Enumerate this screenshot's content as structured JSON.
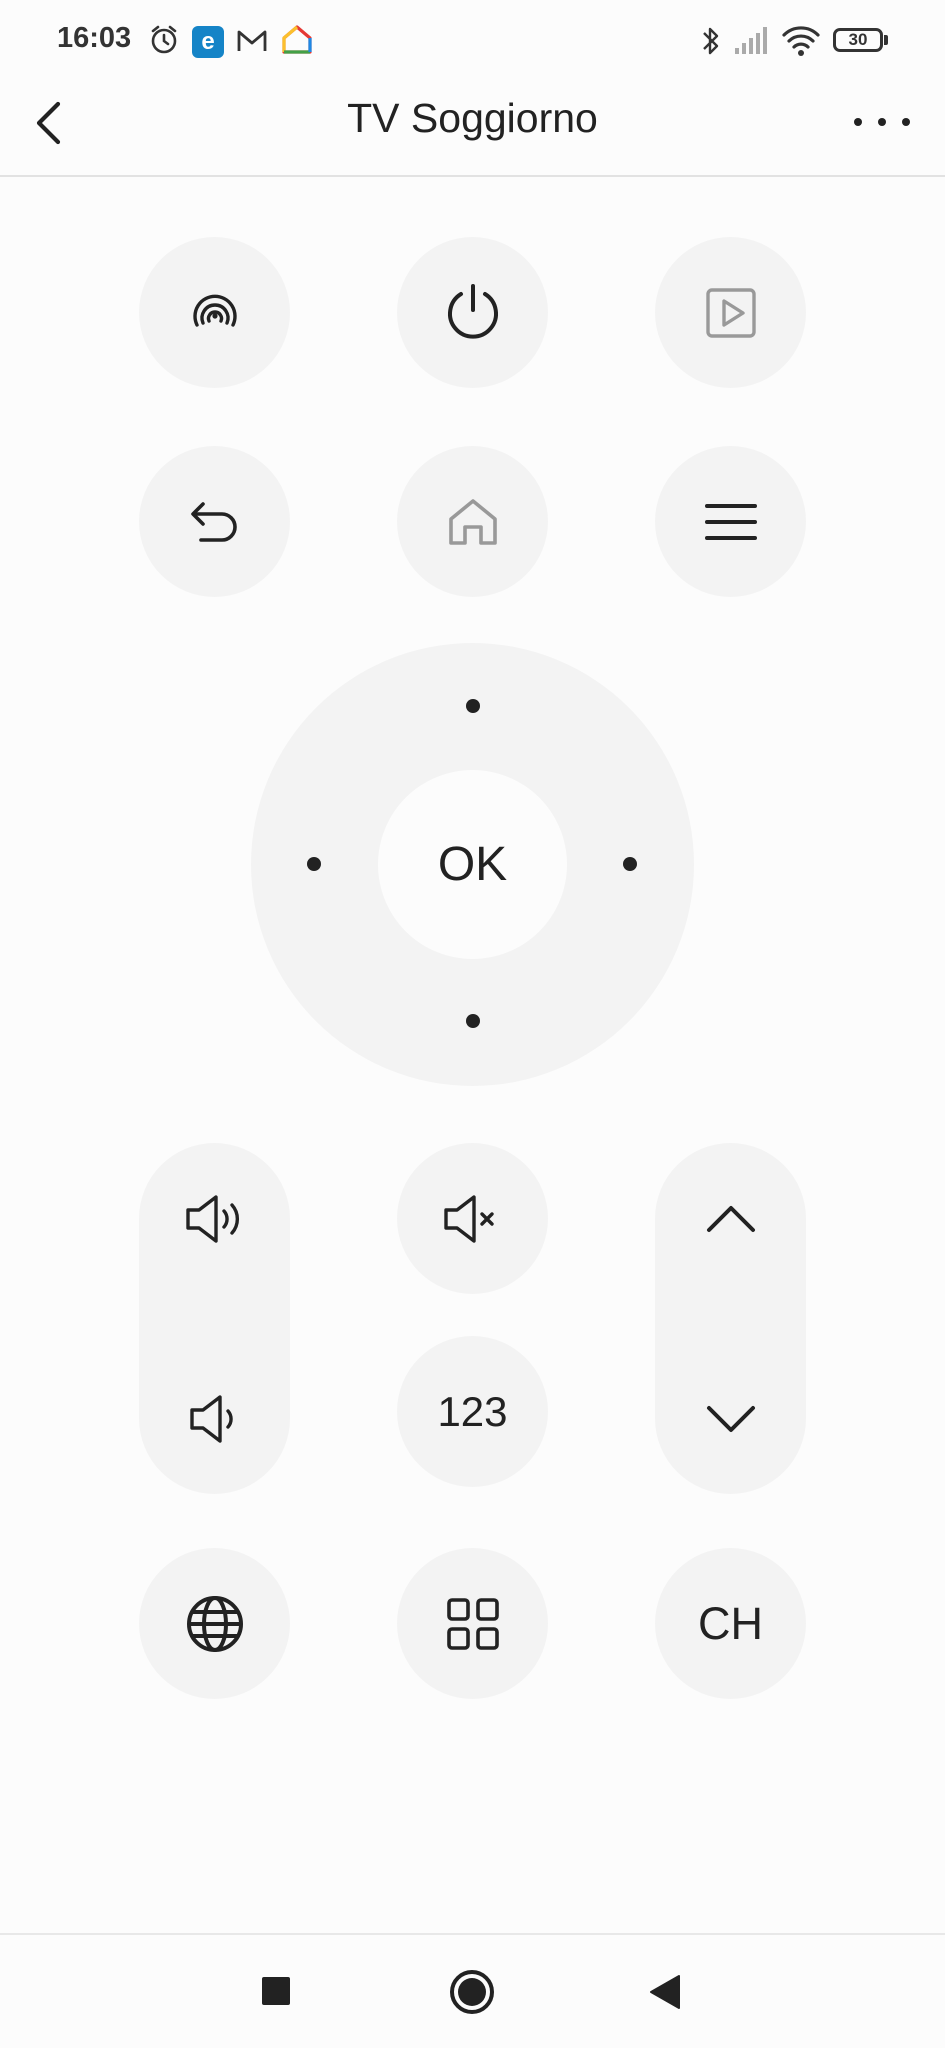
{
  "status_bar": {
    "time": "16:03",
    "battery": "30",
    "icons": [
      "alarm-icon",
      "e-app-icon",
      "gmail-icon",
      "google-home-icon",
      "bluetooth-icon",
      "signal-icon",
      "wifi-icon",
      "battery-icon"
    ]
  },
  "header": {
    "title": "TV Soggiorno",
    "back_icon": "chevron-left-icon",
    "more_icon": "more-horizontal-icon"
  },
  "remote": {
    "row1": [
      "cast-icon",
      "power-icon",
      "input-source-icon"
    ],
    "row2": [
      "back-arrow-icon",
      "home-icon",
      "menu-icon"
    ],
    "dpad": {
      "ok_label": "OK"
    },
    "volume": [
      "volume-up-icon",
      "volume-down-icon"
    ],
    "mute_icon": "mute-icon",
    "numbers_label": "123",
    "channel": [
      "chevron-up-icon",
      "chevron-down-icon"
    ],
    "row5": [
      "globe-icon",
      "apps-grid-icon"
    ],
    "ch_label": "CH"
  },
  "nav_bar": [
    "recents-square-icon",
    "home-circle-icon",
    "back-triangle-icon"
  ]
}
